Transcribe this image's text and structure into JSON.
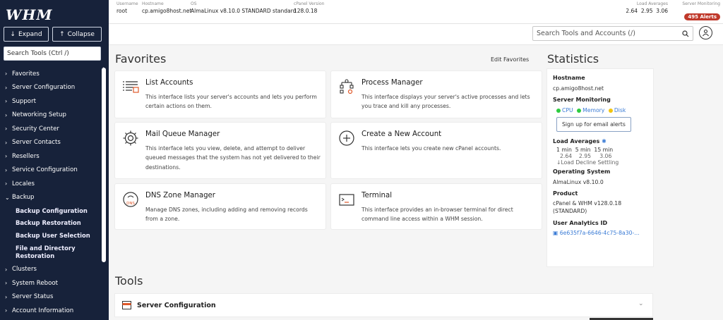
{
  "sidebar": {
    "logo": "WHM",
    "expand_label": "Expand",
    "collapse_label": "Collapse",
    "search_placeholder": "Search Tools (Ctrl /)",
    "items": [
      {
        "label": "Favorites",
        "expanded": false
      },
      {
        "label": "Server Configuration",
        "expanded": false
      },
      {
        "label": "Support",
        "expanded": false
      },
      {
        "label": "Networking Setup",
        "expanded": false
      },
      {
        "label": "Security Center",
        "expanded": false
      },
      {
        "label": "Server Contacts",
        "expanded": false
      },
      {
        "label": "Resellers",
        "expanded": false
      },
      {
        "label": "Service Configuration",
        "expanded": false
      },
      {
        "label": "Locales",
        "expanded": false
      },
      {
        "label": "Backup",
        "expanded": true
      }
    ],
    "backup_subitems": [
      "Backup Configuration",
      "Backup Restoration",
      "Backup User Selection",
      "File and Directory Restoration"
    ],
    "items_after": [
      {
        "label": "Clusters"
      },
      {
        "label": "System Reboot"
      },
      {
        "label": "Server Status"
      },
      {
        "label": "Account Information"
      }
    ]
  },
  "topbar": {
    "username_label": "Username",
    "username": "root",
    "hostname_label": "Hostname",
    "hostname": "cp.amigo8host.net",
    "os_label": "OS",
    "os": "AlmaLinux v8.10.0 STANDARD standard",
    "cpanel_version_label": "cPanel Version",
    "cpanel_version": "128.0.18",
    "load_averages_label": "Load Averages",
    "load_averages": "2.64  2.95  3.06",
    "server_monitoring_label": "Server Monitoring",
    "alerts": "495 Alerts"
  },
  "search": {
    "placeholder": "Search Tools and Accounts (/)"
  },
  "favorites": {
    "title": "Favorites",
    "edit_label": "Edit Favorites",
    "cards": [
      {
        "title": "List Accounts",
        "desc": "This interface lists your server's accounts and lets you perform certain actions on them."
      },
      {
        "title": "Process Manager",
        "desc": "This interface displays your server's active processes and lets you trace and kill any processes."
      },
      {
        "title": "Mail Queue Manager",
        "desc": "This interface lets you view, delete, and attempt to deliver queued messages that the system has not yet delivered to their destinations."
      },
      {
        "title": "Create a New Account",
        "desc": "This interface lets you create new cPanel accounts."
      },
      {
        "title": "DNS Zone Manager",
        "desc": "Manage DNS zones, including adding and removing records from a zone."
      },
      {
        "title": "Terminal",
        "desc": "This interface provides an in-browser terminal for direct command line access within a WHM session."
      }
    ]
  },
  "statistics": {
    "title": "Statistics",
    "hostname_label": "Hostname",
    "hostname": "cp.amigo8host.net",
    "server_monitoring_label": "Server Monitoring",
    "cpu": "CPU",
    "memory": "Memory",
    "disk": "Disk",
    "email_alerts_button": "Sign up for email alerts",
    "load_averages_label": "Load Averages",
    "load_headers": "1 min  5 min  15 min",
    "load_values": "2.64    2.95     3.06",
    "load_decline": "Load Decline Settling",
    "os_label": "Operating System",
    "os": "AlmaLinux v8.10.0",
    "product_label": "Product",
    "product_line1": "cPanel & WHM v128.0.18",
    "product_line2": "(STANDARD)",
    "user_analytics_label": "User Analytics ID",
    "user_analytics_id": "6e635f7a-6646-4c75-8a30-..."
  },
  "tools": {
    "title": "Tools",
    "first_section": "Server Configuration"
  },
  "colors": {
    "sidebar_bg": "#17223a",
    "alert_red": "#c0392b",
    "green": "#2ecc40",
    "yellow": "#f1c40f"
  }
}
